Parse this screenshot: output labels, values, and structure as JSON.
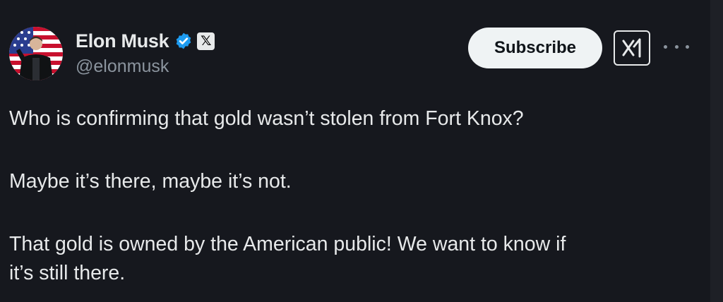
{
  "author": {
    "name": "Elon Musk",
    "handle": "@elonmusk",
    "verified_icon": "verified-badge-icon",
    "affiliate_icon": "x-logo-icon",
    "affiliate_label": "𝕏"
  },
  "actions": {
    "subscribe_label": "Subscribe",
    "grok_icon": "grok-icon",
    "more_icon": "more-options-icon"
  },
  "tweet": {
    "line1": "Who is confirming that gold wasn’t stolen from Fort Knox?",
    "line2": "Maybe it’s there, maybe it’s not.",
    "line3": "That gold is owned by the American public! We want to know if",
    "line4": "it’s still there."
  },
  "colors": {
    "background": "#16181e",
    "text": "#e7e9ea",
    "secondary_text": "#8b949e",
    "verified": "#1d9bf0",
    "button_bg": "#eff3f4"
  }
}
